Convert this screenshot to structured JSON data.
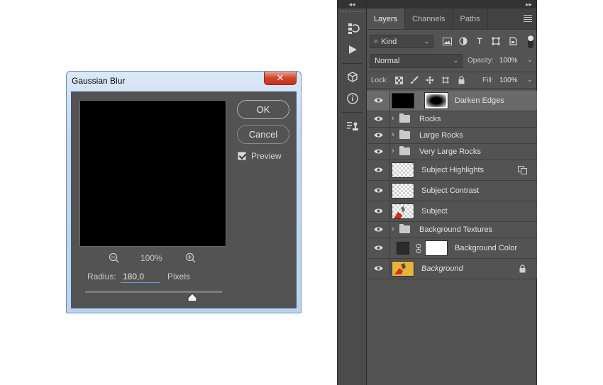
{
  "dialog": {
    "title": "Gaussian Blur",
    "close_label": "✕",
    "ok_label": "OK",
    "cancel_label": "Cancel",
    "preview_label": "Preview",
    "preview_checked": true,
    "zoom_value": "100%",
    "radius_label": "Radius:",
    "radius_value": "180,0",
    "radius_unit": "Pixels",
    "slider_fraction": 0.78
  },
  "toolstrip": {
    "collapse_glyph": "◂◂",
    "icons": [
      "history-brush-icon",
      "play-action-icon",
      "3d-cube-icon",
      "info-icon",
      "properties-stamp-icon"
    ]
  },
  "panel": {
    "expand_glyph": "▸▸",
    "tabs": [
      {
        "label": "Layers",
        "active": true
      },
      {
        "label": "Channels",
        "active": false
      },
      {
        "label": "Paths",
        "active": false
      }
    ],
    "filter_kind": "Kind",
    "blend_mode": "Normal",
    "opacity_label": "Opacity:",
    "opacity_value": "100%",
    "lock_label": "Lock:",
    "fill_label": "Fill:",
    "fill_value": "100%"
  },
  "layers": [
    {
      "name": "Darken Edges",
      "type": "adjust",
      "selected": true
    },
    {
      "name": "Rocks",
      "type": "group"
    },
    {
      "name": "Large Rocks",
      "type": "group"
    },
    {
      "name": "Very Large Rocks",
      "type": "group"
    },
    {
      "name": "Subject Highlights",
      "type": "pixel"
    },
    {
      "name": "Subject Contrast",
      "type": "pixel"
    },
    {
      "name": "Subject",
      "type": "pixel"
    },
    {
      "name": "Background Textures",
      "type": "group"
    },
    {
      "name": "Background Color",
      "type": "fill"
    },
    {
      "name": "Background",
      "type": "background"
    }
  ],
  "colors": {
    "panel_bg": "#535353",
    "selected_row": "#6a6a6a",
    "dialog_frame": "#bcd2ee",
    "close_red": "#c53218"
  }
}
